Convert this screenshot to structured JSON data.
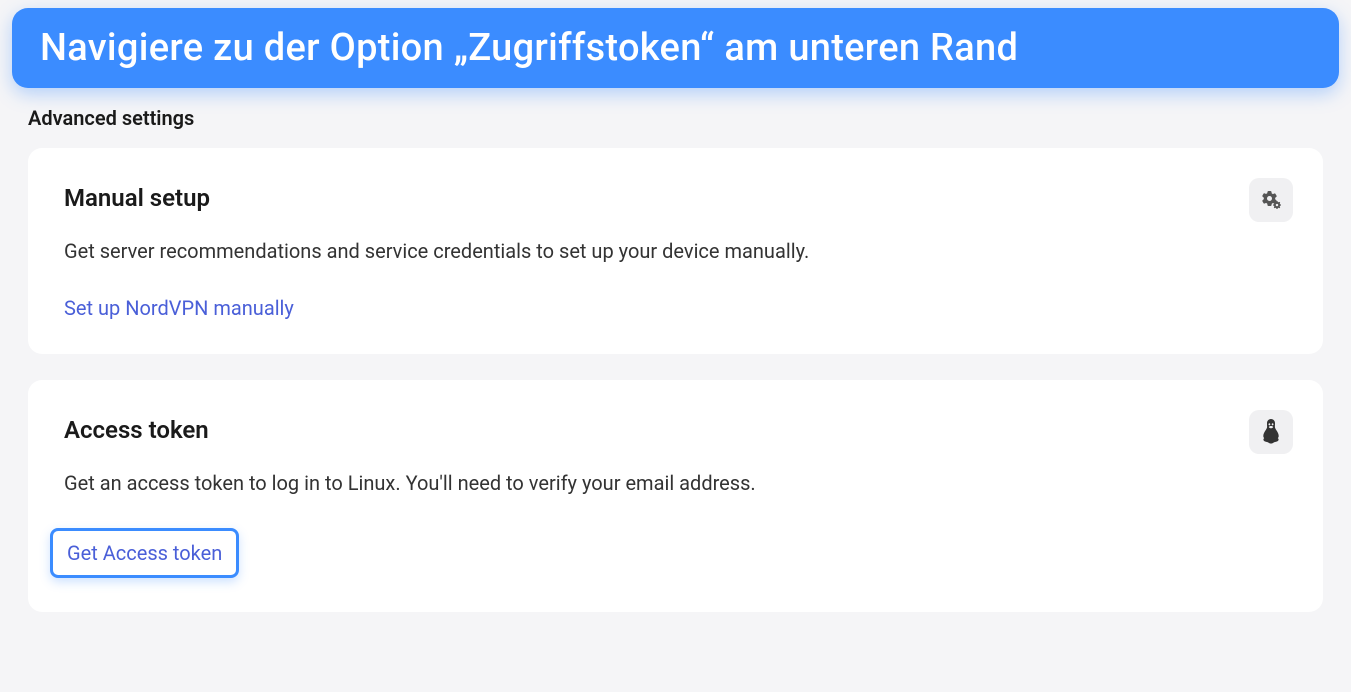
{
  "banner": {
    "text": "Navigiere zu der Option „Zugriffstoken“ am unteren Rand"
  },
  "section": {
    "heading": "Advanced settings"
  },
  "cards": {
    "manualSetup": {
      "title": "Manual setup",
      "description": "Get server recommendations and service credentials to set up your device manually.",
      "linkLabel": "Set up NordVPN manually",
      "iconName": "gears-icon"
    },
    "accessToken": {
      "title": "Access token",
      "description": "Get an access token to log in to Linux. You'll need to verify your email address.",
      "linkLabel": "Get Access token",
      "iconName": "linux-icon"
    }
  }
}
